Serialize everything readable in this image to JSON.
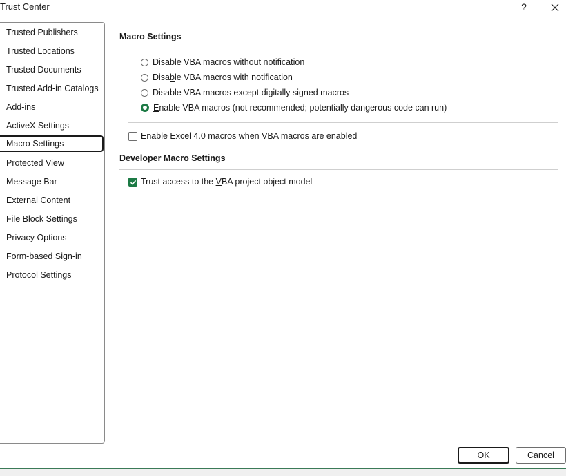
{
  "window": {
    "title": "Trust Center",
    "help_label": "?"
  },
  "sidebar": {
    "items": [
      {
        "label": "Trusted Publishers"
      },
      {
        "label": "Trusted Locations"
      },
      {
        "label": "Trusted Documents"
      },
      {
        "label": "Trusted Add-in Catalogs"
      },
      {
        "label": "Add-ins"
      },
      {
        "label": "ActiveX Settings"
      },
      {
        "label": "Macro Settings",
        "selected": true
      },
      {
        "label": "Protected View"
      },
      {
        "label": "Message Bar"
      },
      {
        "label": "External Content"
      },
      {
        "label": "File Block Settings"
      },
      {
        "label": "Privacy Options"
      },
      {
        "label": "Form-based Sign-in"
      },
      {
        "label": "Protocol Settings"
      }
    ]
  },
  "macro": {
    "heading": "Macro Settings",
    "options": [
      {
        "pre": "Disable VBA ",
        "u": "m",
        "post": "acros without notification",
        "checked": false
      },
      {
        "pre": "Disa",
        "u": "b",
        "post": "le VBA macros with notification",
        "checked": false
      },
      {
        "pre": "Disable VBA macros except ",
        "u": "",
        "post": "digitally signed macros",
        "checked": false
      },
      {
        "pre": "",
        "u": "E",
        "post": "nable VBA macros (not recommended; potentially dangerous code can run)",
        "checked": true
      }
    ],
    "excel4": {
      "pre": "Enable E",
      "u": "x",
      "post": "cel 4.0 macros when VBA macros are enabled",
      "checked": false
    }
  },
  "developer": {
    "heading": "Developer Macro Settings",
    "trust_vba": {
      "pre": "Trust access to the ",
      "u": "V",
      "post": "BA project object model",
      "checked": true
    }
  },
  "buttons": {
    "ok": "OK",
    "cancel": "Cancel"
  },
  "colors": {
    "accent": "#1c7a45"
  }
}
